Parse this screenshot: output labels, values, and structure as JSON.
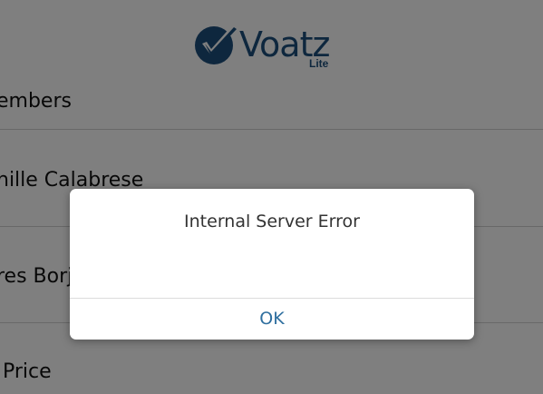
{
  "brand": {
    "name": "Voatz",
    "edition": "Lite",
    "color": "#1c4f7c",
    "logo_icon": "checkmark-circle-icon"
  },
  "list": {
    "items": [
      {
        "label": "embers"
      },
      {
        "label": "nille Calabrese"
      },
      {
        "label": "res Borj"
      },
      {
        "label": "Price"
      }
    ]
  },
  "dialog": {
    "message": "Internal Server Error",
    "ok_label": "OK",
    "ok_color": "#2f6f9f"
  }
}
